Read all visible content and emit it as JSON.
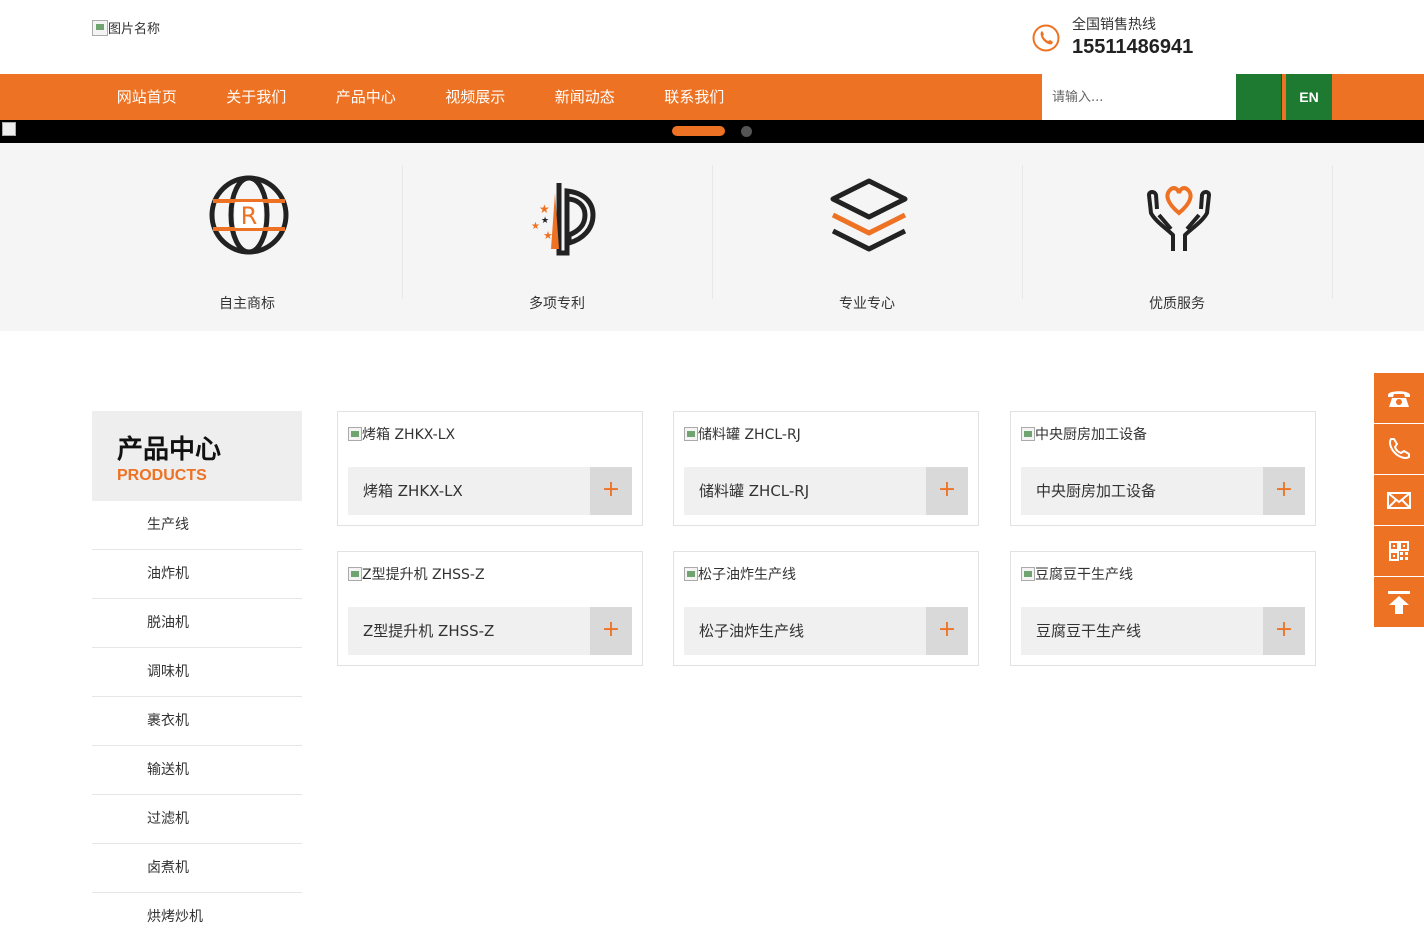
{
  "header": {
    "logo_alt": "图片名称",
    "hotline_label": "全国销售热线",
    "hotline_number": "15511486941"
  },
  "nav": {
    "items": [
      {
        "label": "网站首页"
      },
      {
        "label": "关于我们"
      },
      {
        "label": "产品中心"
      },
      {
        "label": "视频展示"
      },
      {
        "label": "新闻动态"
      },
      {
        "label": "联系我们"
      }
    ],
    "search_placeholder": "请输入...",
    "lang_label": "EN"
  },
  "features": [
    {
      "label": "自主商标",
      "icon": "trademark-globe-icon"
    },
    {
      "label": "多项专利",
      "icon": "patent-icon"
    },
    {
      "label": "专业专心",
      "icon": "layers-icon"
    },
    {
      "label": "优质服务",
      "icon": "heart-hands-icon"
    }
  ],
  "categories": {
    "title": "产品中心",
    "subtitle": "PRODUCTS",
    "items": [
      "生产线",
      "油炸机",
      "脱油机",
      "调味机",
      "裹衣机",
      "输送机",
      "过滤机",
      "卤煮机",
      "烘烤炒机"
    ]
  },
  "products": [
    {
      "img_alt": "烤箱 ZHKX-LX",
      "name": "烤箱 ZHKX-LX"
    },
    {
      "img_alt": "储料罐 ZHCL-RJ",
      "name": "储料罐 ZHCL-RJ"
    },
    {
      "img_alt": "中央厨房加工设备",
      "name": "中央厨房加工设备"
    },
    {
      "img_alt": "Z型提升机 ZHSS-Z",
      "name": "Z型提升机 ZHSS-Z"
    },
    {
      "img_alt": "松子油炸生产线",
      "name": "松子油炸生产线"
    },
    {
      "img_alt": "豆腐豆干生产线",
      "name": "豆腐豆干生产线"
    }
  ],
  "product_plus": "+",
  "colors": {
    "accent": "#ed7223",
    "green": "#1d7a30"
  }
}
